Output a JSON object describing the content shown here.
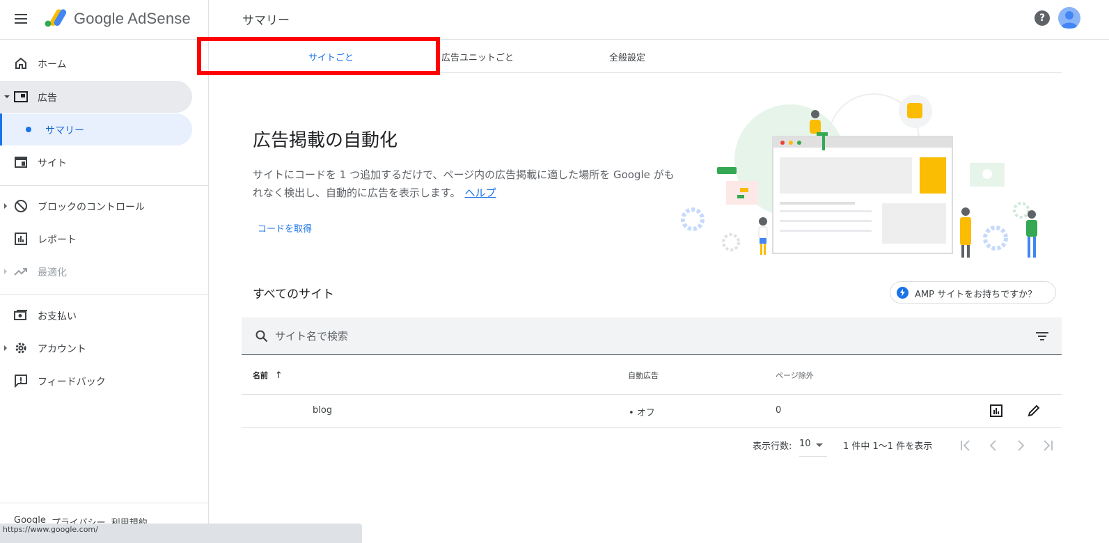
{
  "app": {
    "brand": "Google AdSense",
    "page_title": "サマリー"
  },
  "topbar": {
    "help_label": "?"
  },
  "sidebar": {
    "items": [
      {
        "label": "ホーム",
        "icon": "home-icon"
      },
      {
        "label": "広告",
        "icon": "ads-icon"
      },
      {
        "label": "サマリー",
        "icon": "dot"
      },
      {
        "label": "サイト",
        "icon": "site-icon"
      },
      {
        "label": "ブロックのコントロール",
        "icon": "block-icon"
      },
      {
        "label": "レポート",
        "icon": "report-icon"
      },
      {
        "label": "最適化",
        "icon": "trend-icon"
      },
      {
        "label": "お支払い",
        "icon": "payment-icon"
      },
      {
        "label": "アカウント",
        "icon": "gear-icon"
      },
      {
        "label": "フィードバック",
        "icon": "feedback-icon"
      }
    ],
    "footer": [
      "Google",
      "プライバシー",
      "利用規約"
    ]
  },
  "tabs": [
    {
      "label": "サイトごと",
      "active": true
    },
    {
      "label": "広告ユニットごと",
      "active": false
    },
    {
      "label": "全般設定",
      "active": false
    }
  ],
  "hero": {
    "title": "広告掲載の自動化",
    "description": "サイトにコードを 1 つ追加するだけで、ページ内の広告掲載に適した場所を Google がもれなく検出し、自動的に広告を表示します。",
    "help_link": "ヘルプ",
    "get_code": "コードを取得"
  },
  "sites": {
    "title": "すべてのサイト",
    "amp_chip": "AMP サイトをお持ちですか？",
    "search_placeholder": "サイト名で検索",
    "columns": {
      "name": "名前",
      "sort_arrow": "↑",
      "auto_ads": "自動広告",
      "page_exclusions": "ページ除外"
    },
    "rows": [
      {
        "name": "blog",
        "auto_ads": "• オフ",
        "page_exclusions": "0"
      }
    ]
  },
  "pagination": {
    "rows_label": "表示行数:",
    "rows_value": "10",
    "range_text": "1 件中 1～1 件を表示"
  },
  "statusbar": {
    "url": "https://www.google.com/"
  },
  "colors": {
    "accent": "#1a73e8",
    "highlight": "#ff0000",
    "sidebar_active": "#e8eaed",
    "sidebar_sub": "#e8f0fe"
  }
}
